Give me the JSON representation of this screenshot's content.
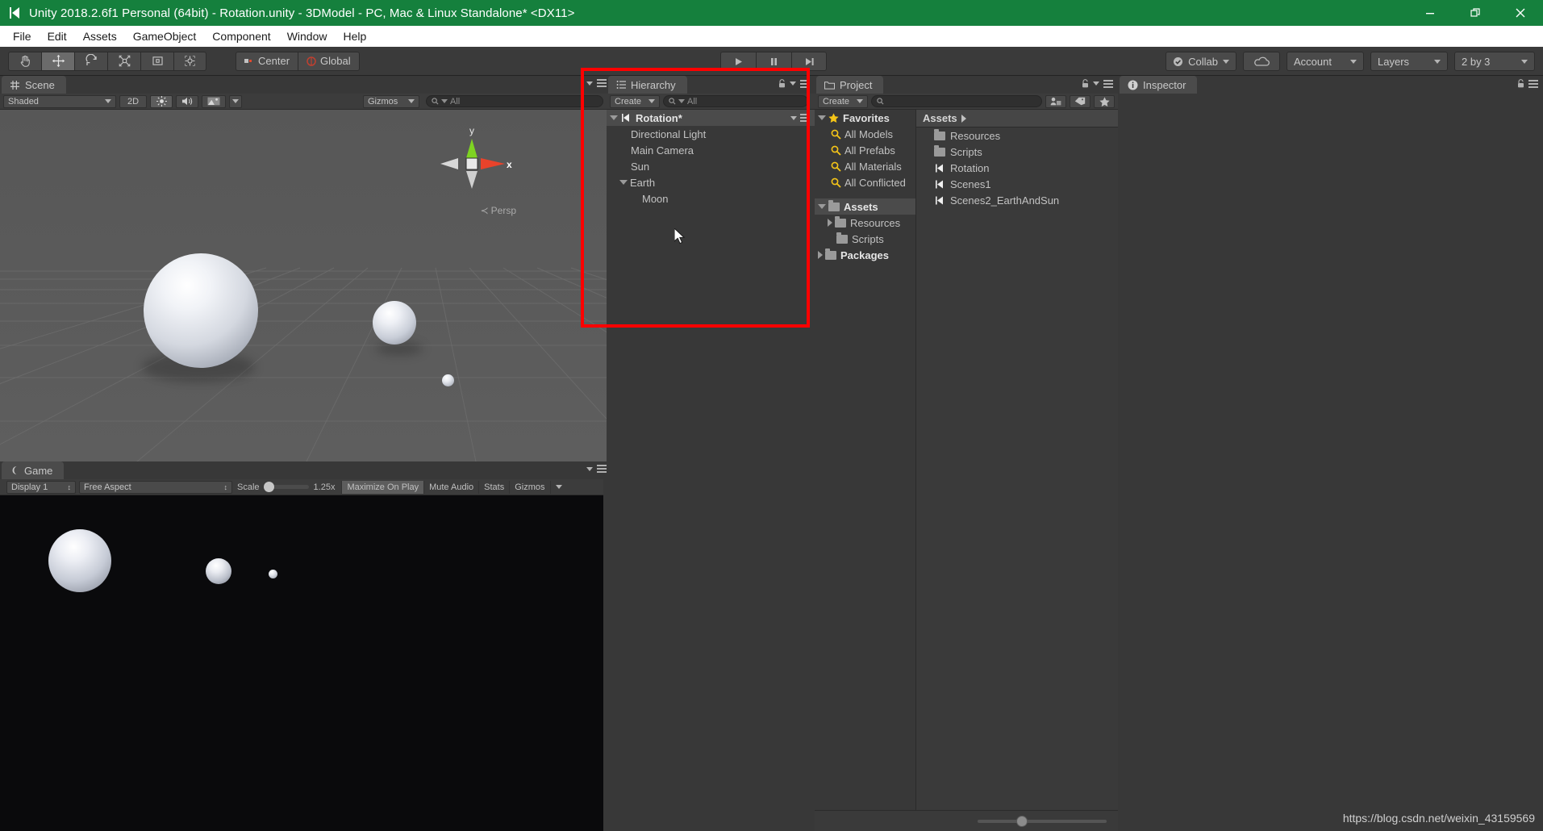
{
  "window": {
    "title": "Unity 2018.2.6f1 Personal (64bit) - Rotation.unity - 3DModel - PC, Mac & Linux Standalone* <DX11>",
    "minimize_label": "—",
    "maximize_label": "❐",
    "close_label": "✕",
    "titlebar_color": "#15803d"
  },
  "menubar": {
    "items": [
      "File",
      "Edit",
      "Assets",
      "GameObject",
      "Component",
      "Window",
      "Help"
    ]
  },
  "toolbar": {
    "tools": [
      {
        "name": "hand-tool",
        "glyph": "✋"
      },
      {
        "name": "move-tool",
        "glyph": "✥"
      },
      {
        "name": "rotate-tool",
        "glyph": "↺"
      },
      {
        "name": "scale-tool",
        "glyph": "⤡"
      },
      {
        "name": "rect-tool",
        "glyph": "▣"
      },
      {
        "name": "transform-tool",
        "glyph": "✲"
      }
    ],
    "active_tool_index": 1,
    "pivot_mode": "Center",
    "pivot_rotation": "Global",
    "play": "▶",
    "pause": "‖",
    "step": "▶|",
    "collab": "Collab",
    "cloud_icon": "cloud-icon",
    "account": "Account",
    "layers": "Layers",
    "layout": "2 by 3"
  },
  "scene": {
    "tab_label": "Scene",
    "draw_mode": "Shaded",
    "two_d": "2D",
    "lighting_icon": "lighting-icon",
    "audio_icon": "audio-icon",
    "fx_icon": "effects-icon",
    "gizmos": "Gizmos",
    "search_placeholder": "All",
    "gizmo_axis_y": "y",
    "gizmo_axis_x": "x",
    "perspective_label": "Persp",
    "background_color": "#5a5a5a",
    "axis_y_color": "#7ed321",
    "axis_x_color": "#e8432b"
  },
  "game": {
    "tab_label": "Game",
    "display": "Display 1",
    "aspect": "Free Aspect",
    "scale_label": "Scale",
    "scale_value": "1.25x",
    "maximize_on_play": "Maximize On Play",
    "mute_audio": "Mute Audio",
    "stats": "Stats",
    "gizmos": "Gizmos",
    "background_color": "#0a0a0c"
  },
  "hierarchy": {
    "tab_label": "Hierarchy",
    "create_label": "Create",
    "search_placeholder": "All",
    "scene_name": "Rotation*",
    "items": [
      {
        "label": "Directional Light",
        "depth": 1,
        "expandable": false
      },
      {
        "label": "Main Camera",
        "depth": 1,
        "expandable": false
      },
      {
        "label": "Sun",
        "depth": 1,
        "expandable": false
      },
      {
        "label": "Earth",
        "depth": 1,
        "expandable": true,
        "expanded": true
      },
      {
        "label": "Moon",
        "depth": 2,
        "expandable": false
      }
    ]
  },
  "project": {
    "tab_label": "Project",
    "create_label": "Create",
    "search_placeholder": "",
    "favorites_label": "Favorites",
    "favorites": [
      "All Models",
      "All Prefabs",
      "All Materials",
      "All Conflicted"
    ],
    "assets_label": "Assets",
    "tree": [
      {
        "label": "Resources",
        "depth": 1,
        "type": "folder",
        "expandable": true
      },
      {
        "label": "Scripts",
        "depth": 1,
        "type": "folder",
        "expandable": false
      }
    ],
    "packages_label": "Packages",
    "breadcrumb": "Assets",
    "contents": [
      {
        "label": "Resources",
        "type": "folder"
      },
      {
        "label": "Scripts",
        "type": "folder"
      },
      {
        "label": "Rotation",
        "type": "scene"
      },
      {
        "label": "Scenes1",
        "type": "scene"
      },
      {
        "label": "Scenes2_EarthAndSun",
        "type": "scene"
      }
    ],
    "filter_icons": [
      "search-by-type-icon",
      "search-by-label-icon",
      "favorite-icon"
    ]
  },
  "inspector": {
    "tab_label": "Inspector"
  },
  "annotation": {
    "highlight_color": "#ff0000",
    "cursor": "arrow-cursor"
  },
  "watermark": "https://blog.csdn.net/weixin_43159569"
}
